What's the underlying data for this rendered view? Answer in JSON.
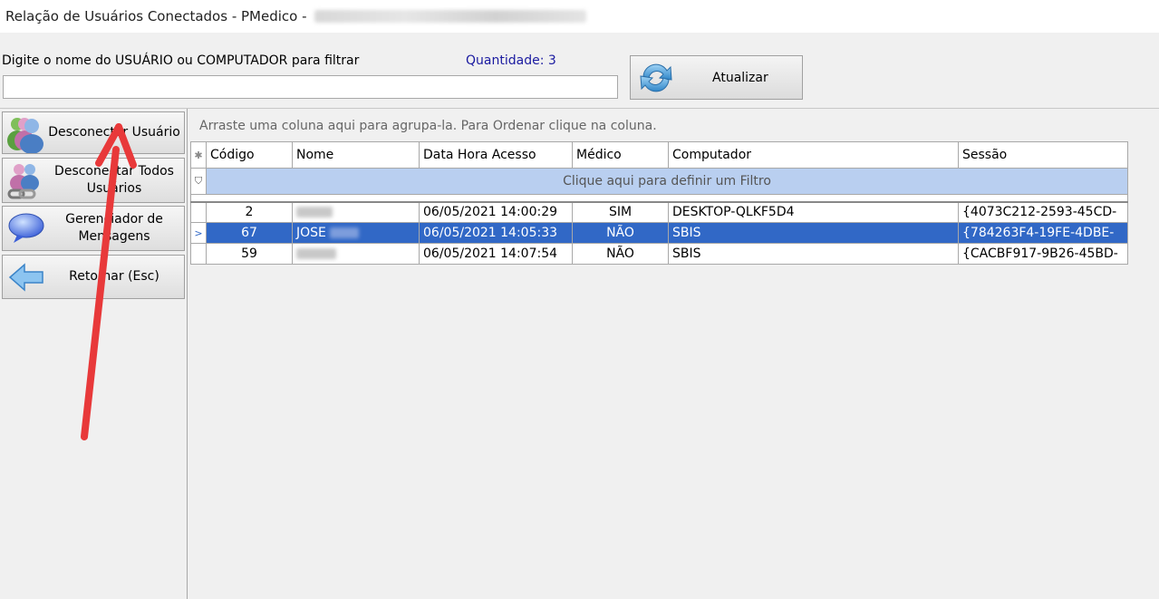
{
  "window": {
    "title": "Relação de Usuários Conectados - PMedico -"
  },
  "filter": {
    "label": "Digite o nome do USUÁRIO ou COMPUTADOR para filtrar",
    "value": "",
    "quantity_label": "Quantidade: 3"
  },
  "toolbar": {
    "refresh_label": "Atualizar",
    "refresh_icon": "refresh-icon"
  },
  "sidebar": {
    "items": [
      {
        "label": "Desconectar Usuário",
        "icon": "users-disconnect-icon"
      },
      {
        "label": "Desconectar Todos Usuários",
        "icon": "users-chain-icon"
      },
      {
        "label": "Gerenciador de Mensagens",
        "icon": "speech-bubble-icon"
      },
      {
        "label": "Retornar (Esc)",
        "icon": "arrow-left-icon"
      }
    ]
  },
  "grid": {
    "group_hint": "Arraste uma coluna aqui para agrupa-la. Para Ordenar clique na coluna.",
    "filter_hint": "Clique aqui para definir um Filtro",
    "columns": [
      "Código",
      "Nome",
      "Data Hora Acesso",
      "Médico",
      "Computador",
      "Sessão"
    ],
    "rows": [
      {
        "codigo": "2",
        "nome": "",
        "data": "06/05/2021 14:00:29",
        "medico": "SIM",
        "computador": "DESKTOP-QLKF5D4",
        "sessao": "{4073C212-2593-45CD-"
      },
      {
        "codigo": "67",
        "nome": "JOSE",
        "data": "06/05/2021 14:05:33",
        "medico": "NÃO",
        "computador": "SBIS",
        "sessao": "{784263F4-19FE-4DBE-"
      },
      {
        "codigo": "59",
        "nome": "",
        "data": "06/05/2021 14:07:54",
        "medico": "NÃO",
        "computador": "SBIS",
        "sessao": "{CACBF917-9B26-45BD-"
      }
    ],
    "selected_row": 1
  },
  "colors": {
    "selection": "#3168c6",
    "filter_row": "#b9cff0",
    "annotation_arrow": "#e8393a"
  }
}
